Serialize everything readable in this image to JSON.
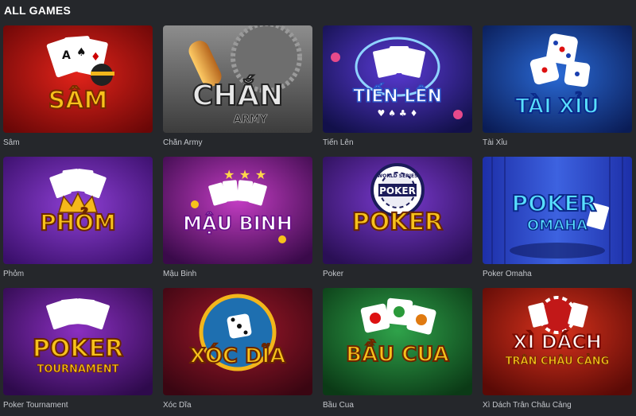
{
  "section": {
    "title": "ALL GAMES"
  },
  "games": [
    {
      "caption": "Sâm",
      "logo": "SÂM",
      "icon": "playing-cards-icon"
    },
    {
      "caption": "Chắn Army",
      "logo": "CHẮN",
      "logo_sub": "ARMY",
      "icon": "bullet-icon"
    },
    {
      "caption": "Tiến Lên",
      "logo": "TIẾN LÊN",
      "icon": "playing-cards-icon"
    },
    {
      "caption": "Tài Xỉu",
      "logo": "TÀI XỈU",
      "icon": "dice-icon"
    },
    {
      "caption": "Phỏm",
      "logo": "PHỎM",
      "icon": "crown-icon"
    },
    {
      "caption": "Mậu Binh",
      "logo": "MẬU BINH",
      "icon": "playing-cards-icon"
    },
    {
      "caption": "Poker",
      "logo": "POKER",
      "logo_chip": "POKER",
      "logo_chip_top": "WORLD SERIES",
      "icon": "poker-chip-icon"
    },
    {
      "caption": "Poker Omaha",
      "logo": "POKER",
      "logo_sub": "OMAHA",
      "icon": "stage-curtain-icon"
    },
    {
      "caption": "Poker Tournament",
      "logo": "POKER",
      "logo_sub": "TOURNAMENT",
      "icon": "playing-cards-icon"
    },
    {
      "caption": "Xóc Dĩa",
      "logo": "XÓC DĨA",
      "icon": "dice-bowl-icon"
    },
    {
      "caption": "Bầu Cua",
      "logo": "BẦU CUA",
      "icon": "dice-icon"
    },
    {
      "caption": "Xì Dách Trân Châu Cảng",
      "logo": "XÌ DÁCH",
      "logo_sub": "TRÂN CHÂU CẢNG",
      "icon": "poker-chip-icon"
    }
  ],
  "colors": {
    "page_bg": "#25272b",
    "caption": "#c4c7cc",
    "title": "#ffffff",
    "logo_gold": "#f7c21b",
    "logo_cyan": "#58e0ff"
  }
}
